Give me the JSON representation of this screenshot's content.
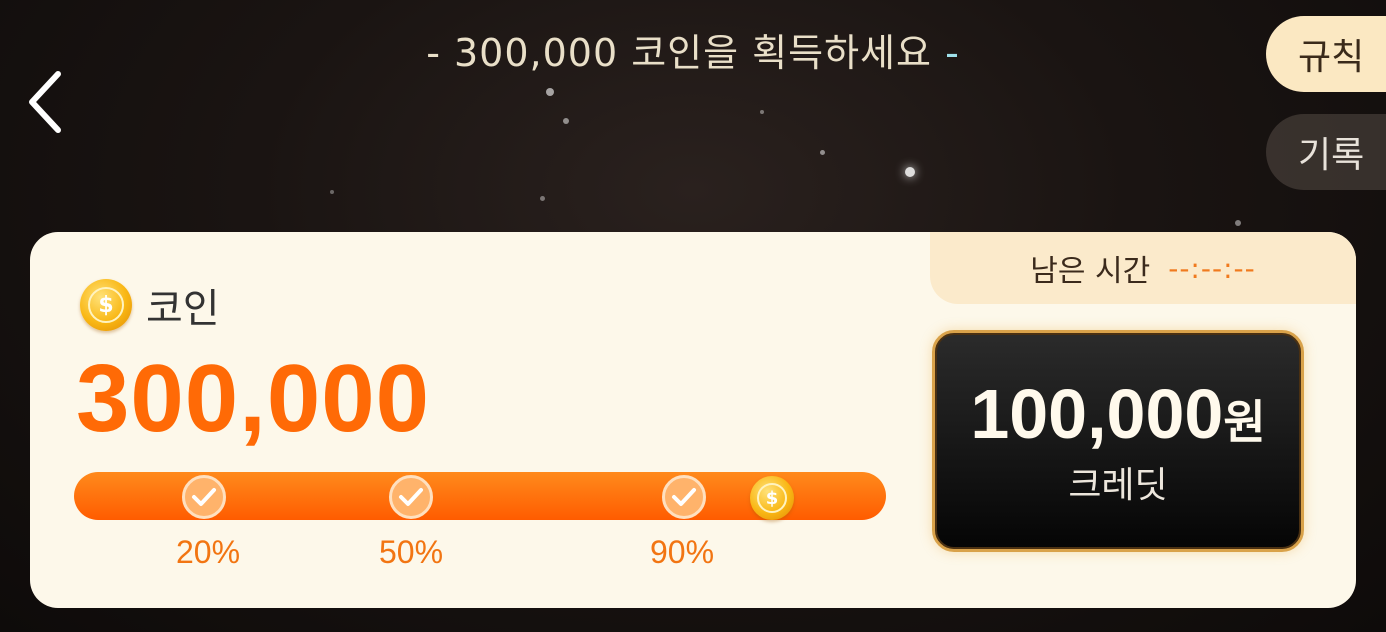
{
  "header": {
    "title": "300,000 코인을 획득하세요",
    "dash": "-"
  },
  "side_buttons": {
    "rules": "규칙",
    "records": "기록"
  },
  "card": {
    "timer_label": "남은 시간",
    "timer_value": "--:--:--",
    "coin_label": "코인",
    "coin_symbol": "$",
    "amount": "300,000",
    "progress": {
      "fraction": 0.87,
      "milestones": [
        "20%",
        "50%",
        "90%"
      ]
    },
    "reward": {
      "amount": "100,000",
      "unit": "원",
      "subtitle": "크레딧"
    }
  },
  "icons": [
    "chevron-left-icon",
    "coin-icon",
    "check-icon"
  ],
  "colors": {
    "accent": "#ff6a06",
    "card_bg": "#fdf8ea",
    "rules_bg": "#fbe8c2"
  }
}
